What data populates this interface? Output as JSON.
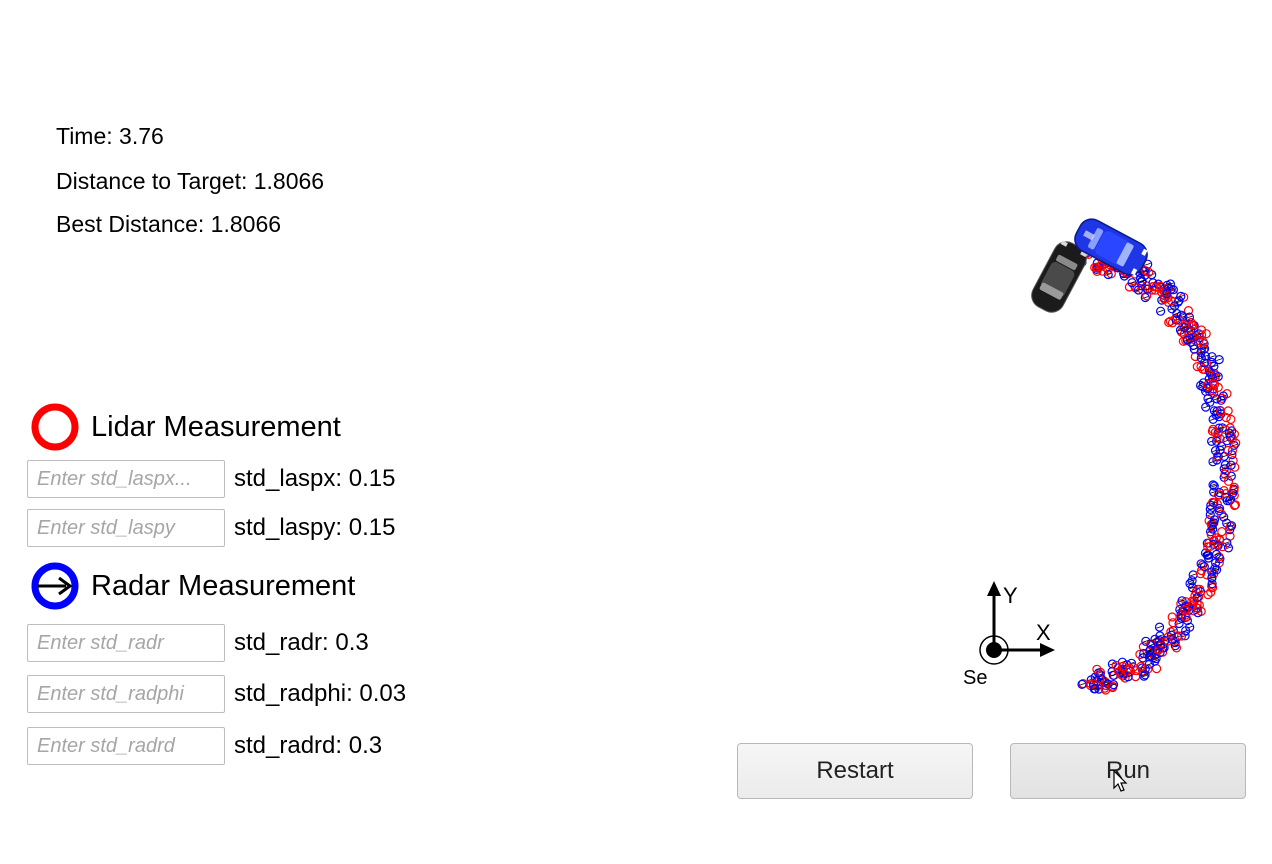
{
  "stats": {
    "time": "Time: 3.76",
    "distance": "Distance to Target: 1.8066",
    "best": "Best Distance: 1.8066"
  },
  "lidar": {
    "title": "Lidar Measurement",
    "color": "#ff0000",
    "fields": [
      {
        "placeholder": "Enter std_laspx...",
        "label": "std_laspx: 0.15"
      },
      {
        "placeholder": "Enter std_laspy",
        "label": "std_laspy: 0.15"
      }
    ]
  },
  "radar": {
    "title": "Radar Measurement",
    "color": "#0000ff",
    "fields": [
      {
        "placeholder": "Enter std_radr",
        "label": "std_radr: 0.3"
      },
      {
        "placeholder": "Enter std_radphi",
        "label": "std_radphi: 0.03"
      },
      {
        "placeholder": "Enter std_radrd",
        "label": "std_radrd: 0.3"
      }
    ]
  },
  "sensor": {
    "x_label": "X",
    "y_label": "Y",
    "name": "Se"
  },
  "buttons": {
    "restart": "Restart",
    "run": "Run"
  }
}
